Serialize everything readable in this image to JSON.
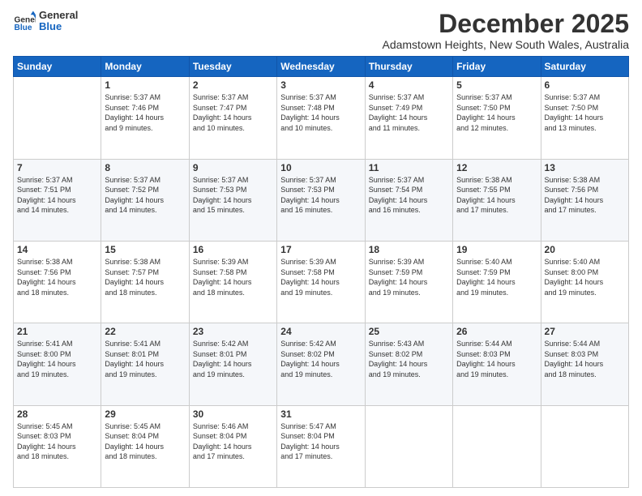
{
  "logo": {
    "line1": "General",
    "line2": "Blue"
  },
  "title": "December 2025",
  "subtitle": "Adamstown Heights, New South Wales, Australia",
  "days_of_week": [
    "Sunday",
    "Monday",
    "Tuesday",
    "Wednesday",
    "Thursday",
    "Friday",
    "Saturday"
  ],
  "weeks": [
    [
      {
        "day": "",
        "info": ""
      },
      {
        "day": "1",
        "info": "Sunrise: 5:37 AM\nSunset: 7:46 PM\nDaylight: 14 hours\nand 9 minutes."
      },
      {
        "day": "2",
        "info": "Sunrise: 5:37 AM\nSunset: 7:47 PM\nDaylight: 14 hours\nand 10 minutes."
      },
      {
        "day": "3",
        "info": "Sunrise: 5:37 AM\nSunset: 7:48 PM\nDaylight: 14 hours\nand 10 minutes."
      },
      {
        "day": "4",
        "info": "Sunrise: 5:37 AM\nSunset: 7:49 PM\nDaylight: 14 hours\nand 11 minutes."
      },
      {
        "day": "5",
        "info": "Sunrise: 5:37 AM\nSunset: 7:50 PM\nDaylight: 14 hours\nand 12 minutes."
      },
      {
        "day": "6",
        "info": "Sunrise: 5:37 AM\nSunset: 7:50 PM\nDaylight: 14 hours\nand 13 minutes."
      }
    ],
    [
      {
        "day": "7",
        "info": "Sunrise: 5:37 AM\nSunset: 7:51 PM\nDaylight: 14 hours\nand 14 minutes."
      },
      {
        "day": "8",
        "info": "Sunrise: 5:37 AM\nSunset: 7:52 PM\nDaylight: 14 hours\nand 14 minutes."
      },
      {
        "day": "9",
        "info": "Sunrise: 5:37 AM\nSunset: 7:53 PM\nDaylight: 14 hours\nand 15 minutes."
      },
      {
        "day": "10",
        "info": "Sunrise: 5:37 AM\nSunset: 7:53 PM\nDaylight: 14 hours\nand 16 minutes."
      },
      {
        "day": "11",
        "info": "Sunrise: 5:37 AM\nSunset: 7:54 PM\nDaylight: 14 hours\nand 16 minutes."
      },
      {
        "day": "12",
        "info": "Sunrise: 5:38 AM\nSunset: 7:55 PM\nDaylight: 14 hours\nand 17 minutes."
      },
      {
        "day": "13",
        "info": "Sunrise: 5:38 AM\nSunset: 7:56 PM\nDaylight: 14 hours\nand 17 minutes."
      }
    ],
    [
      {
        "day": "14",
        "info": "Sunrise: 5:38 AM\nSunset: 7:56 PM\nDaylight: 14 hours\nand 18 minutes."
      },
      {
        "day": "15",
        "info": "Sunrise: 5:38 AM\nSunset: 7:57 PM\nDaylight: 14 hours\nand 18 minutes."
      },
      {
        "day": "16",
        "info": "Sunrise: 5:39 AM\nSunset: 7:58 PM\nDaylight: 14 hours\nand 18 minutes."
      },
      {
        "day": "17",
        "info": "Sunrise: 5:39 AM\nSunset: 7:58 PM\nDaylight: 14 hours\nand 19 minutes."
      },
      {
        "day": "18",
        "info": "Sunrise: 5:39 AM\nSunset: 7:59 PM\nDaylight: 14 hours\nand 19 minutes."
      },
      {
        "day": "19",
        "info": "Sunrise: 5:40 AM\nSunset: 7:59 PM\nDaylight: 14 hours\nand 19 minutes."
      },
      {
        "day": "20",
        "info": "Sunrise: 5:40 AM\nSunset: 8:00 PM\nDaylight: 14 hours\nand 19 minutes."
      }
    ],
    [
      {
        "day": "21",
        "info": "Sunrise: 5:41 AM\nSunset: 8:00 PM\nDaylight: 14 hours\nand 19 minutes."
      },
      {
        "day": "22",
        "info": "Sunrise: 5:41 AM\nSunset: 8:01 PM\nDaylight: 14 hours\nand 19 minutes."
      },
      {
        "day": "23",
        "info": "Sunrise: 5:42 AM\nSunset: 8:01 PM\nDaylight: 14 hours\nand 19 minutes."
      },
      {
        "day": "24",
        "info": "Sunrise: 5:42 AM\nSunset: 8:02 PM\nDaylight: 14 hours\nand 19 minutes."
      },
      {
        "day": "25",
        "info": "Sunrise: 5:43 AM\nSunset: 8:02 PM\nDaylight: 14 hours\nand 19 minutes."
      },
      {
        "day": "26",
        "info": "Sunrise: 5:44 AM\nSunset: 8:03 PM\nDaylight: 14 hours\nand 19 minutes."
      },
      {
        "day": "27",
        "info": "Sunrise: 5:44 AM\nSunset: 8:03 PM\nDaylight: 14 hours\nand 18 minutes."
      }
    ],
    [
      {
        "day": "28",
        "info": "Sunrise: 5:45 AM\nSunset: 8:03 PM\nDaylight: 14 hours\nand 18 minutes."
      },
      {
        "day": "29",
        "info": "Sunrise: 5:45 AM\nSunset: 8:04 PM\nDaylight: 14 hours\nand 18 minutes."
      },
      {
        "day": "30",
        "info": "Sunrise: 5:46 AM\nSunset: 8:04 PM\nDaylight: 14 hours\nand 17 minutes."
      },
      {
        "day": "31",
        "info": "Sunrise: 5:47 AM\nSunset: 8:04 PM\nDaylight: 14 hours\nand 17 minutes."
      },
      {
        "day": "",
        "info": ""
      },
      {
        "day": "",
        "info": ""
      },
      {
        "day": "",
        "info": ""
      }
    ]
  ]
}
